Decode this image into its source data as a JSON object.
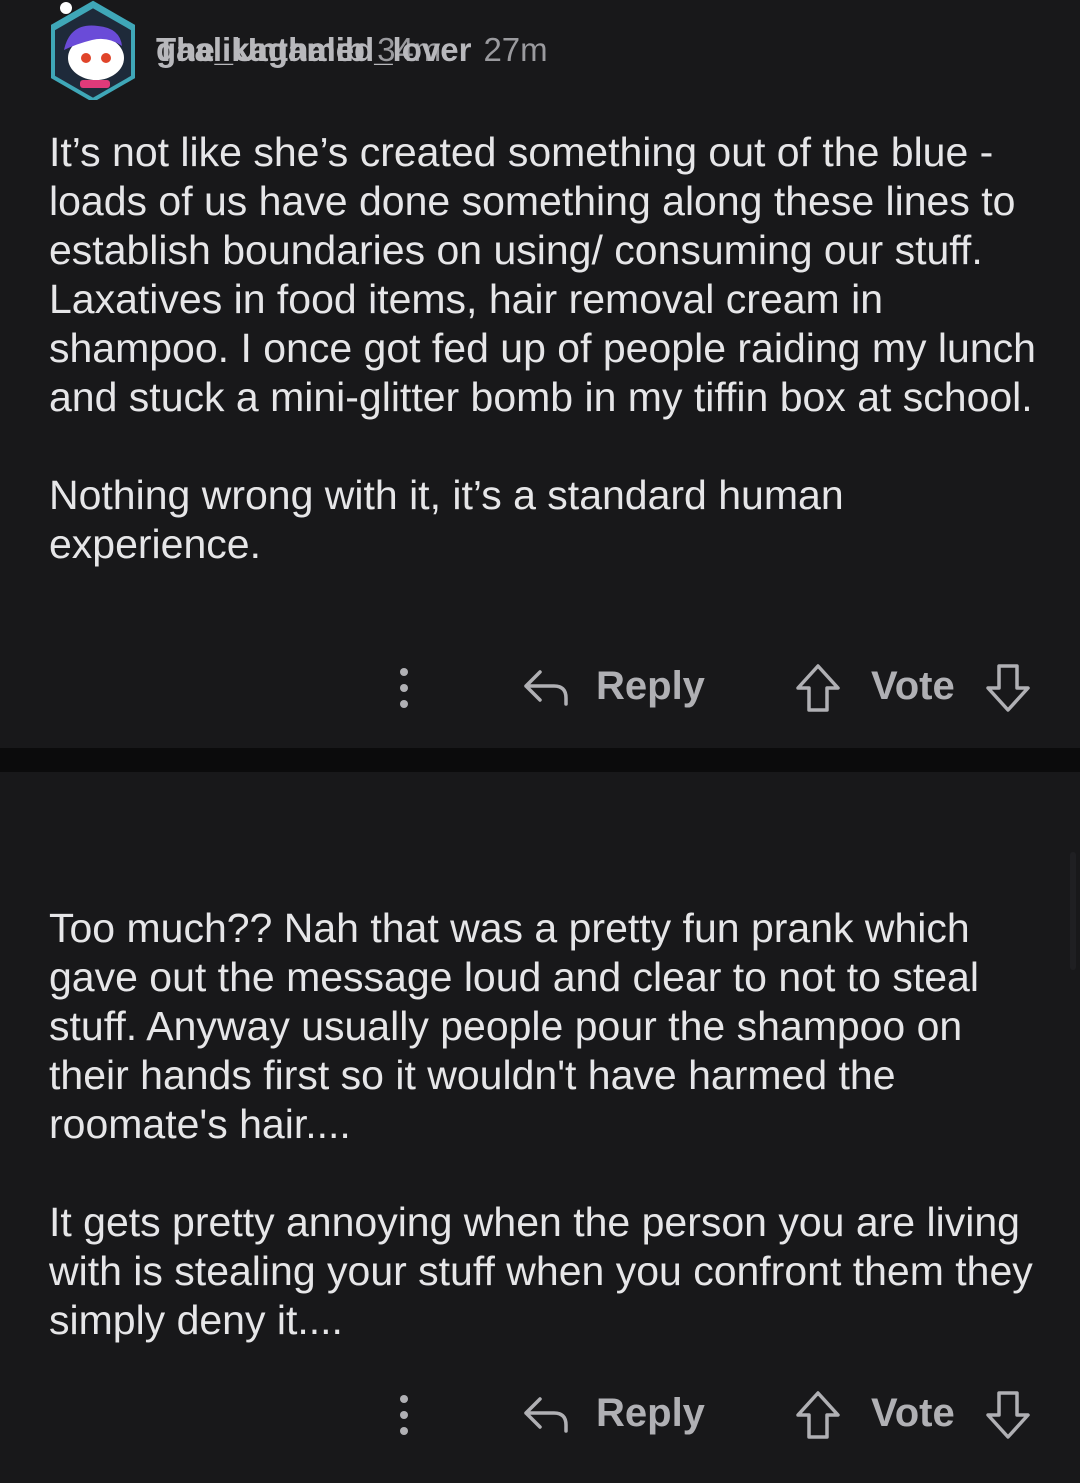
{
  "comments": [
    {
      "author": "gaalikaghalib",
      "time": "34m",
      "paragraphs": [
        "It’s not like she’s created something out of the blue - loads of us have done something along these lines to establish boundaries on using/ consuming our stuff. Laxatives in food items, hair removal cream in shampoo. I once got fed up of people raiding my lunch and stuck a mini-glitter bomb in my tiffin box at school.",
        "Nothing wrong with it, it’s a standard human experience."
      ],
      "reply_label": "Reply",
      "vote_label": "Vote",
      "avatar_icon": "snoo-avatar-bearded"
    },
    {
      "author": "The_Untamed_lover",
      "time": "27m",
      "paragraphs": [
        "Too much?? Nah that was a pretty fun prank which gave out the message loud and clear to not to steal stuff. Anyway usually people pour the shampoo on their hands first so it wouldn't have harmed the roomate's hair....",
        "It gets pretty annoying when the person you are living with is stealing your stuff when you confront them they simply deny it...."
      ],
      "reply_label": "Reply",
      "vote_label": "Vote",
      "avatar_icon": "snoo-avatar-purple-hair"
    }
  ],
  "colors": {
    "background": "#0b0b0c",
    "card": "#18181a",
    "text": "#e6e6e8",
    "muted": "#9a9a9e",
    "avatar_ring": "#3fa7b8"
  }
}
